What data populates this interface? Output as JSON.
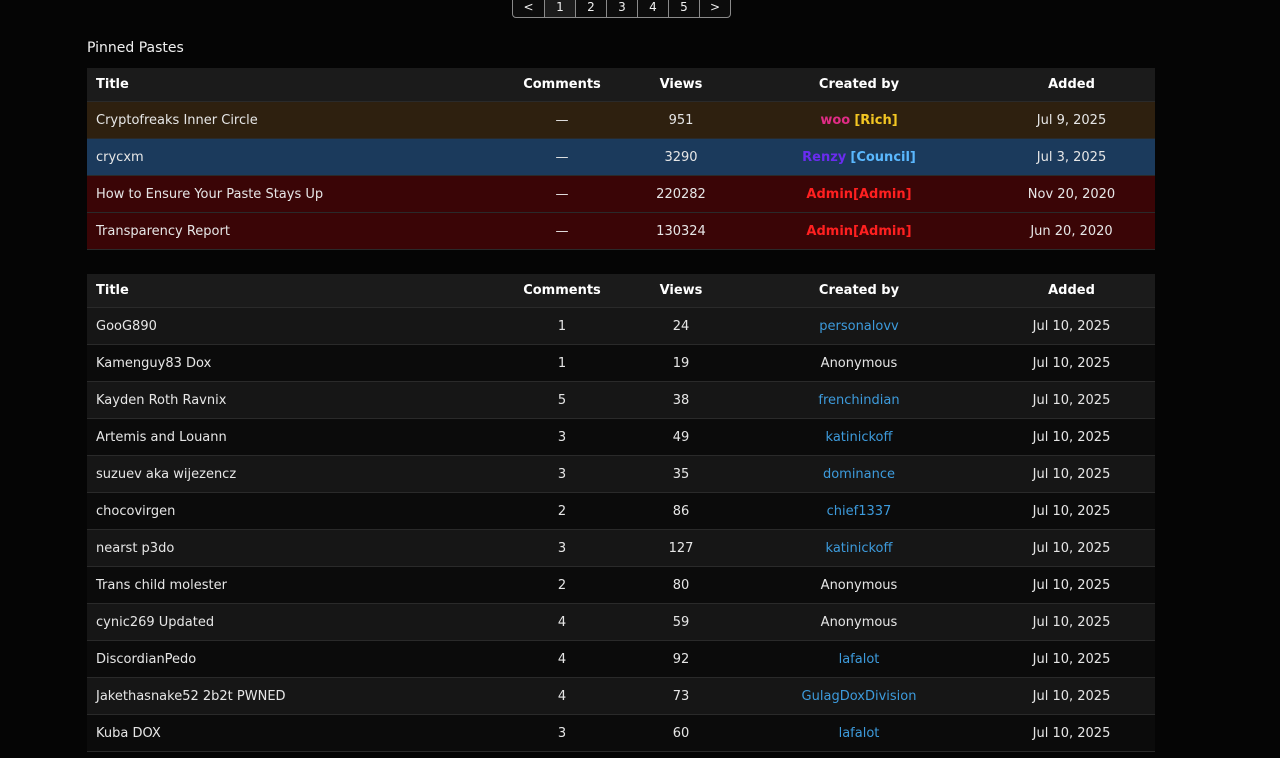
{
  "pagination": {
    "prev": "<",
    "pages": [
      "1",
      "2",
      "3",
      "4",
      "5"
    ],
    "current": "1",
    "next": ">"
  },
  "pinned": {
    "heading": "Pinned Pastes",
    "columns": {
      "title": "Title",
      "comments": "Comments",
      "views": "Views",
      "created_by": "Created by",
      "added": "Added"
    },
    "rows": [
      {
        "title": "Cryptofreaks Inner Circle",
        "comments": "—",
        "views": "951",
        "user": "woo",
        "rank": "[Rich]",
        "added": "Jul 9, 2025"
      },
      {
        "title": "crycxm",
        "comments": "—",
        "views": "3290",
        "user": "Renzy",
        "rank": "[Council]",
        "added": "Jul 3, 2025"
      },
      {
        "title": "How to Ensure Your Paste Stays Up",
        "comments": "—",
        "views": "220282",
        "user": "Admin",
        "rank": "[Admin]",
        "added": "Nov 20, 2020"
      },
      {
        "title": "Transparency Report",
        "comments": "—",
        "views": "130324",
        "user": "Admin",
        "rank": "[Admin]",
        "added": "Jun 20, 2020"
      }
    ]
  },
  "recent": {
    "columns": {
      "title": "Title",
      "comments": "Comments",
      "views": "Views",
      "created_by": "Created by",
      "added": "Added"
    },
    "rows": [
      {
        "title": "GooG890",
        "comments": "1",
        "views": "24",
        "user": "personalovv",
        "added": "Jul 10, 2025"
      },
      {
        "title": "Kamenguy83 Dox",
        "comments": "1",
        "views": "19",
        "user": "Anonymous",
        "added": "Jul 10, 2025"
      },
      {
        "title": "Kayden Roth Ravnix",
        "comments": "5",
        "views": "38",
        "user": "frenchindian",
        "added": "Jul 10, 2025"
      },
      {
        "title": "Artemis and Louann",
        "comments": "3",
        "views": "49",
        "user": "katinickoff",
        "added": "Jul 10, 2025"
      },
      {
        "title": "suzuev aka wijezencz",
        "comments": "3",
        "views": "35",
        "user": "dominance",
        "added": "Jul 10, 2025"
      },
      {
        "title": "chocovirgen",
        "comments": "2",
        "views": "86",
        "user": "chief1337",
        "added": "Jul 10, 2025"
      },
      {
        "title": "nearst p3do",
        "comments": "3",
        "views": "127",
        "user": "katinickoff",
        "added": "Jul 10, 2025"
      },
      {
        "title": "Trans child molester",
        "comments": "2",
        "views": "80",
        "user": "Anonymous",
        "added": "Jul 10, 2025"
      },
      {
        "title": "cynic269 Updated",
        "comments": "4",
        "views": "59",
        "user": "Anonymous",
        "added": "Jul 10, 2025"
      },
      {
        "title": "DiscordianPedo",
        "comments": "4",
        "views": "92",
        "user": "lafalot",
        "added": "Jul 10, 2025"
      },
      {
        "title": "Jakethasnake52 2b2t PWNED",
        "comments": "4",
        "views": "73",
        "user": "GulagDoxDivision",
        "added": "Jul 10, 2025"
      },
      {
        "title": "Kuba DOX",
        "comments": "3",
        "views": "60",
        "user": "lafalot",
        "added": "Jul 10, 2025"
      }
    ]
  },
  "colors": {
    "link": "#3d9bdc",
    "admin": "#ff2020",
    "rich_name": "#e02c86",
    "rich_tag": "#f3c623",
    "council_name": "#6a2cf0",
    "council_tag": "#5ab8ff"
  }
}
